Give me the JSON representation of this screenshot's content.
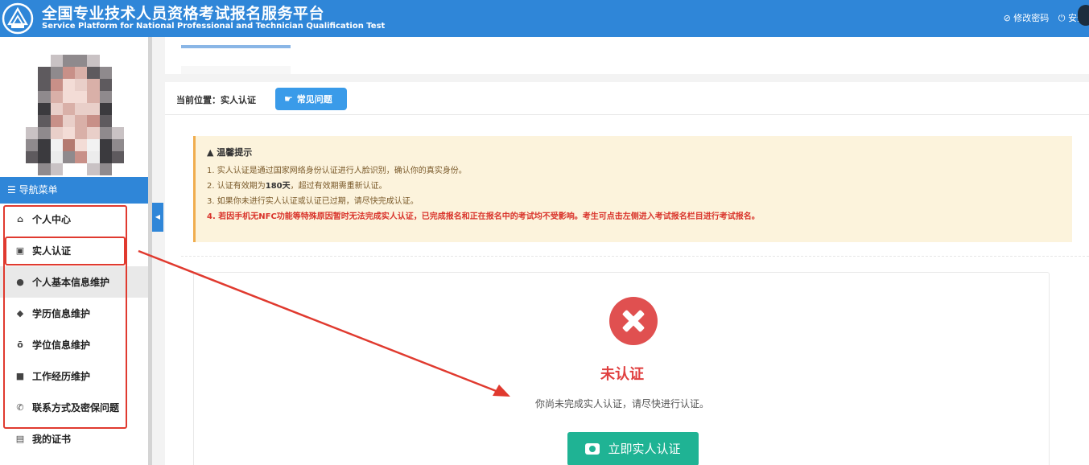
{
  "header": {
    "title_cn": "全国专业技术人员资格考试报名服务平台",
    "title_en": "Service Platform for National Professional and Technician Qualification Test",
    "change_password": "⊘ 修改密码",
    "logout": "⏻ 安全"
  },
  "sidebar": {
    "nav_header": "☰ 导航菜单",
    "items": [
      {
        "label": "个人中心",
        "icon": "home-icon",
        "glyph": "⌂"
      },
      {
        "label": "实人认证",
        "icon": "id-card-icon",
        "glyph": "▣"
      },
      {
        "label": "个人基本信息维护",
        "icon": "user-icon",
        "glyph": "●"
      },
      {
        "label": "学历信息维护",
        "icon": "graduation-cap-icon",
        "glyph": "◆"
      },
      {
        "label": "学位信息维护",
        "icon": "degree-icon",
        "glyph": "ō"
      },
      {
        "label": "工作经历维护",
        "icon": "briefcase-icon",
        "glyph": "■"
      },
      {
        "label": "联系方式及密保问题",
        "icon": "phone-icon",
        "glyph": "✆"
      },
      {
        "label": "我的证书",
        "icon": "certificate-icon",
        "glyph": "▤"
      }
    ]
  },
  "main": {
    "breadcrumb": "当前位置：实人认证",
    "faq_button": "常见问题",
    "notice": {
      "title": "▲ 温馨提示",
      "line1": "1. 实人认证是通过国家网络身份认证进行人脸识别，确认你的真实身份。",
      "line2_prefix": "2. 认证有效期为",
      "line2_bold": "180天",
      "line2_suffix": "，超过有效期需重新认证。",
      "line3": "3. 如果你未进行实人认证或认证已过期，请尽快完成认证。",
      "line4": "4. 若因手机无NFC功能等特殊原因暂时无法完成实人认证，已完成报名和正在报名中的考试均不受影响。考生可点击左侧进入考试报名栏目进行考试报名。"
    },
    "status": {
      "title": "未认证",
      "description": "你尚未完成实人认证，请尽快进行认证。",
      "button": "立即实人认证"
    }
  },
  "colors": {
    "primary": "#2f86d8",
    "annotation_red": "#e03a2f",
    "success_green": "#1fb394",
    "error_red": "#e05050",
    "notice_bg": "#fcf3dc"
  }
}
